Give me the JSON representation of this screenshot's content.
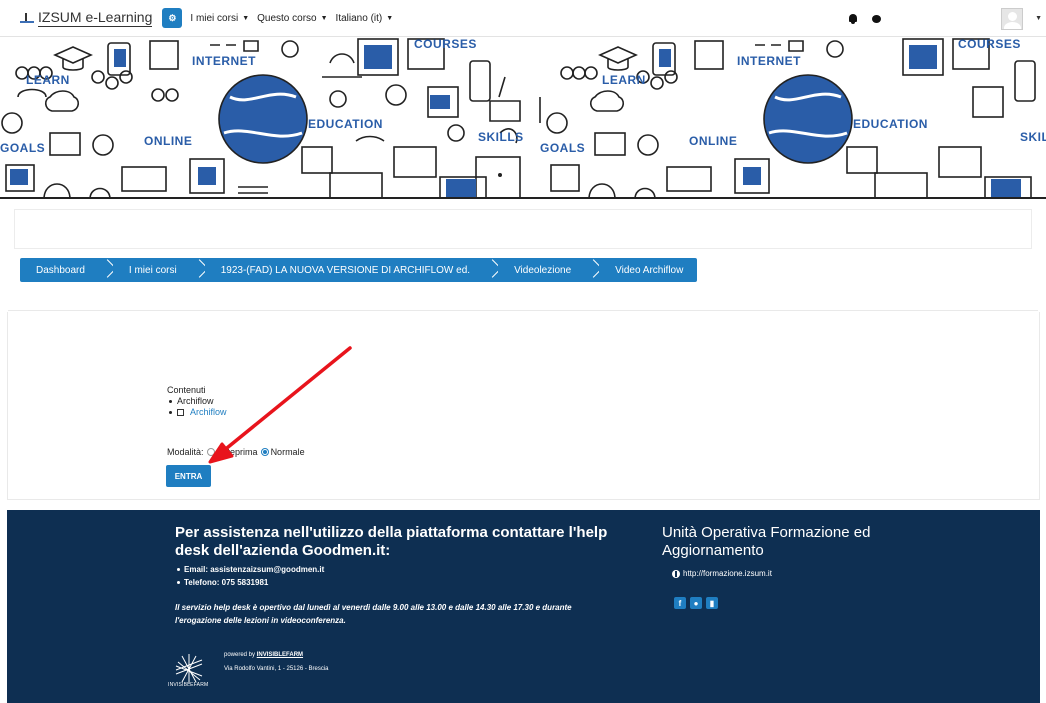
{
  "navbar": {
    "brand": "IZSUM e-Learning",
    "menu": [
      {
        "label": "I miei corsi"
      },
      {
        "label": "Questo corso"
      },
      {
        "label": "Italiano (it)"
      }
    ]
  },
  "banner": {
    "words": [
      "COURSES",
      "INTERNET",
      "LEARN",
      "EDUCATION",
      "SKILLS",
      "ONLINE",
      "GOALS"
    ]
  },
  "breadcrumb": [
    {
      "label": "Dashboard"
    },
    {
      "label": "I miei corsi"
    },
    {
      "label": "1923-(FAD) LA NUOVA VERSIONE DI ARCHIFLOW ed."
    },
    {
      "label": "Videolezione"
    },
    {
      "label": "Video Archiflow"
    }
  ],
  "content": {
    "heading": "Contenuti",
    "items": [
      "Archiflow",
      "Archiflow"
    ],
    "mode_label": "Modalità:",
    "mode_options": [
      "Anteprima",
      "Normale"
    ],
    "selected_mode": "Normale",
    "enter_button": "ENTRA"
  },
  "footer": {
    "help_title": "Per assistenza nell'utilizzo della piattaforma contattare l'help desk dell'azienda Goodmen.it:",
    "email": "Email: assistenzaizsum@goodmen.it",
    "phone": "Telefono: 075 5831981",
    "note": "Il servizio help desk è opertivo dal lunedì al venerdì dalle 9.00 alle 13.00 e dalle 14.30 alle 17.30 e durante l'erogazione delle lezioni in videoconferenza.",
    "powered_prefix": "powered by",
    "powered_brand": "INVISIBLEFARM",
    "address": "Via Rodolfo Vantini, 1 - 25126 - Brescia",
    "logo_text": "INVISIBLEFARM",
    "unit_title": "Unità Operativa Formazione ed Aggiornamento",
    "url": "http://formazione.izsum.it"
  },
  "colors": {
    "accent": "#1f7ec1",
    "footer_bg": "#0e2f52",
    "banner_blue": "#2a5da8",
    "arrow": "#e8141c"
  }
}
